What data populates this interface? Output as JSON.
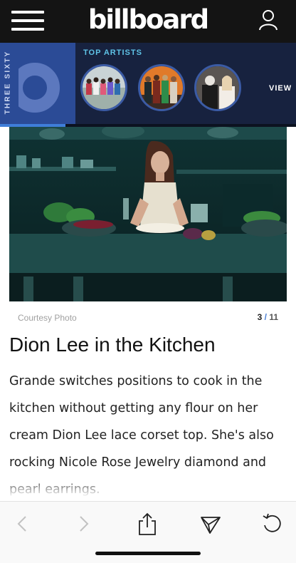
{
  "header": {
    "logo": "billboard",
    "menu_icon": "hamburger-icon",
    "account_icon": "user-icon"
  },
  "artists_bar": {
    "panel_label": "THREE SIXTY",
    "title": "TOP ARTISTS",
    "view_label": "VIEW",
    "avatars": [
      "group-photo",
      "band-photo",
      "duo-photo"
    ],
    "progress": 0.22,
    "colors": {
      "title": "#5fc3e6",
      "panel": "#2b4b96",
      "bar": "#17223f"
    }
  },
  "gallery": {
    "credit": "Courtesy Photo",
    "current": "3",
    "separator": "/",
    "total": "11",
    "title": "Dion Lee in the Kitchen",
    "caption": "Grande switches positions to cook in the kitchen without getting any flour on her cream Dion Lee lace corset top. She's also rocking Nicole Rose Jewelry diamond and pearl earrings."
  },
  "toolbar": {
    "back_icon": "chevron-left-icon",
    "forward_icon": "chevron-right-icon",
    "share_icon": "share-icon",
    "send_icon": "send-icon",
    "reload_icon": "reload-icon"
  }
}
